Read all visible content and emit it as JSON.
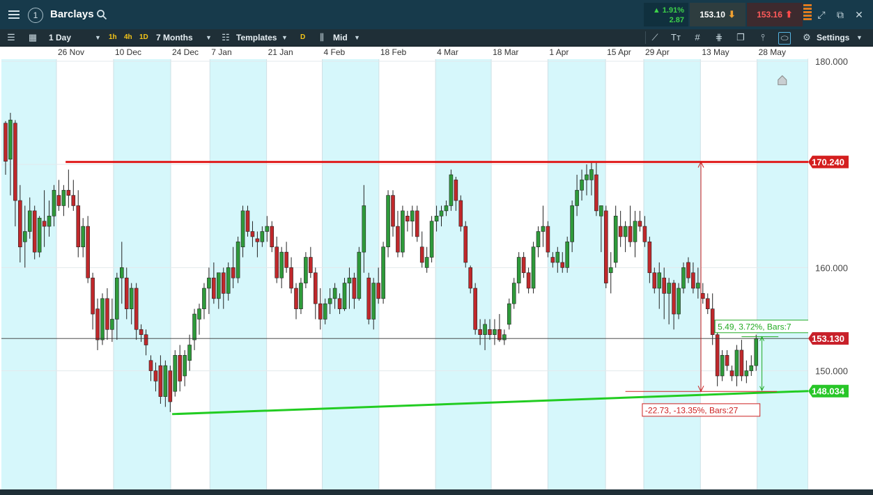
{
  "header": {
    "symbol": "Barclays",
    "account_number": "1",
    "change_pct": "▲ 1.91%",
    "change_abs": "2.87",
    "bid": "153.10",
    "ask": "153.16"
  },
  "toolbar": {
    "interval": "1 Day",
    "quick_1h": "1h",
    "quick_4h": "4h",
    "quick_1d": "1D",
    "range": "7 Months",
    "templates": "Templates",
    "d_label": "D",
    "price_type": "Mid",
    "settings": "Settings"
  },
  "chart_data": {
    "type": "candlestick",
    "x_tick_labels": [
      "26 Nov",
      "10 Dec",
      "24 Dec",
      "7 Jan",
      "21 Jan",
      "4 Feb",
      "18 Feb",
      "4 Mar",
      "18 Mar",
      "1 Apr",
      "15 Apr",
      "29 Apr",
      "13 May",
      "28 May"
    ],
    "y_tick_labels": [
      "180.000",
      "170.000",
      "160.000",
      "150.000"
    ],
    "ylim": [
      138.5,
      180.2
    ],
    "y_visible_ticks": [
      180,
      170,
      160,
      150
    ],
    "grid": true,
    "colors": {
      "up": "#2e9a3a",
      "down": "#c0282b",
      "resistance": "#e01b1b",
      "support": "#22cc22",
      "band": "#d6f7fb",
      "measure_up": "#22aa22",
      "measure_down": "#cc2020"
    },
    "current_price": 153.13,
    "current_price_label": "153.130",
    "resistance": {
      "value": 170.24,
      "label": "170.240",
      "start": "26 Nov"
    },
    "support": {
      "value": 148.034,
      "label": "148.034",
      "start_value": 145.8,
      "start": "24 Dec"
    },
    "measure_down_label": "-22.73, -13.35%, Bars:27",
    "measure_up_label": "5.49, 3.72%, Bars:7",
    "candles": [
      [
        174.0,
        174.2,
        169.0,
        170.3
      ],
      [
        170.5,
        175.0,
        167.0,
        174.3
      ],
      [
        174.0,
        174.3,
        164.0,
        166.5
      ],
      [
        166.5,
        168.0,
        160.5,
        162.0
      ],
      [
        162.5,
        166.0,
        160.0,
        163.5
      ],
      [
        163.5,
        166.8,
        162.8,
        165.5
      ],
      [
        165.5,
        166.0,
        160.8,
        161.5
      ],
      [
        161.5,
        165.0,
        161.0,
        164.8
      ],
      [
        164.5,
        167.5,
        162.0,
        164.0
      ],
      [
        164.0,
        166.5,
        163.0,
        165.0
      ],
      [
        165.0,
        168.0,
        164.0,
        167.5
      ],
      [
        167.0,
        168.5,
        165.5,
        166.0
      ],
      [
        166.0,
        168.0,
        165.0,
        167.5
      ],
      [
        167.5,
        169.5,
        165.8,
        167.0
      ],
      [
        167.0,
        168.5,
        165.5,
        166.0
      ],
      [
        166.0,
        167.5,
        161.0,
        162.0
      ],
      [
        162.0,
        164.8,
        161.0,
        164.0
      ],
      [
        164.0,
        165.0,
        158.5,
        159.0
      ],
      [
        159.0,
        159.5,
        154.0,
        155.5
      ],
      [
        156.0,
        157.0,
        152.0,
        153.0
      ],
      [
        153.0,
        157.5,
        152.5,
        157.0
      ],
      [
        157.0,
        158.0,
        153.0,
        154.0
      ],
      [
        154.0,
        157.0,
        152.8,
        155.0
      ],
      [
        155.0,
        159.5,
        153.0,
        159.0
      ],
      [
        159.0,
        162.5,
        156.5,
        160.0
      ],
      [
        159.0,
        160.0,
        155.0,
        156.0
      ],
      [
        156.0,
        158.5,
        154.5,
        158.0
      ],
      [
        158.0,
        158.5,
        153.0,
        154.0
      ],
      [
        154.0,
        154.5,
        152.8,
        153.5
      ],
      [
        153.5,
        154.0,
        151.5,
        152.5
      ],
      [
        151.0,
        151.5,
        149.0,
        150.0
      ],
      [
        150.0,
        150.8,
        148.0,
        149.0
      ],
      [
        150.5,
        151.5,
        146.8,
        147.5
      ],
      [
        147.5,
        151.0,
        146.5,
        150.5
      ],
      [
        150.0,
        150.5,
        146.0,
        147.0
      ],
      [
        148.0,
        152.0,
        147.5,
        151.5
      ],
      [
        151.5,
        152.5,
        148.0,
        149.0
      ],
      [
        149.5,
        152.0,
        148.5,
        151.5
      ],
      [
        151.0,
        153.5,
        150.0,
        152.5
      ],
      [
        153.0,
        156.0,
        152.0,
        155.5
      ],
      [
        155.0,
        156.5,
        153.5,
        156.0
      ],
      [
        156.0,
        158.5,
        155.0,
        158.0
      ],
      [
        158.0,
        160.0,
        155.5,
        159.0
      ],
      [
        159.0,
        160.5,
        156.5,
        157.0
      ],
      [
        157.0,
        159.5,
        156.0,
        159.5
      ],
      [
        159.5,
        160.0,
        156.0,
        157.5
      ],
      [
        157.5,
        160.5,
        156.8,
        160.0
      ],
      [
        160.0,
        162.0,
        158.0,
        159.0
      ],
      [
        159.0,
        163.0,
        158.5,
        162.5
      ],
      [
        162.0,
        166.0,
        161.0,
        165.5
      ],
      [
        165.5,
        166.0,
        163.0,
        163.5
      ],
      [
        163.5,
        164.5,
        162.0,
        163.0
      ],
      [
        162.8,
        163.5,
        161.0,
        162.5
      ],
      [
        162.5,
        164.0,
        162.0,
        163.5
      ],
      [
        163.5,
        165.0,
        162.5,
        164.0
      ],
      [
        164.0,
        164.5,
        161.5,
        162.0
      ],
      [
        162.0,
        163.0,
        158.5,
        159.0
      ],
      [
        159.0,
        162.0,
        158.0,
        161.5
      ],
      [
        161.5,
        162.5,
        159.5,
        160.0
      ],
      [
        160.0,
        161.0,
        157.5,
        158.0
      ],
      [
        158.0,
        158.5,
        155.0,
        156.0
      ],
      [
        156.0,
        159.0,
        155.5,
        158.5
      ],
      [
        158.5,
        161.5,
        158.0,
        161.0
      ],
      [
        161.0,
        162.0,
        159.0,
        159.5
      ],
      [
        159.5,
        160.0,
        155.0,
        156.5
      ],
      [
        156.5,
        158.0,
        154.0,
        155.0
      ],
      [
        155.0,
        157.0,
        154.5,
        156.5
      ],
      [
        156.5,
        158.0,
        155.5,
        157.0
      ],
      [
        157.0,
        158.5,
        156.0,
        158.0
      ],
      [
        157.0,
        157.5,
        155.5,
        156.0
      ],
      [
        156.0,
        159.0,
        155.8,
        158.5
      ],
      [
        158.5,
        160.0,
        156.0,
        159.0
      ],
      [
        159.0,
        159.5,
        156.0,
        157.0
      ],
      [
        157.0,
        162.0,
        156.8,
        161.5
      ],
      [
        161.5,
        168.0,
        159.5,
        166.0
      ],
      [
        159.0,
        159.5,
        154.5,
        155.0
      ],
      [
        155.0,
        159.0,
        154.0,
        158.5
      ],
      [
        158.5,
        160.0,
        156.5,
        157.0
      ],
      [
        157.0,
        162.5,
        156.5,
        162.0
      ],
      [
        162.0,
        167.5,
        161.0,
        167.0
      ],
      [
        167.0,
        167.5,
        163.0,
        164.0
      ],
      [
        164.0,
        165.5,
        161.0,
        161.5
      ],
      [
        161.5,
        166.0,
        161.0,
        165.5
      ],
      [
        165.0,
        165.5,
        163.5,
        164.5
      ],
      [
        164.5,
        166.0,
        163.0,
        165.5
      ],
      [
        165.5,
        166.0,
        162.5,
        163.0
      ],
      [
        162.0,
        163.5,
        160.0,
        160.5
      ],
      [
        160.0,
        162.0,
        159.5,
        161.0
      ],
      [
        161.0,
        165.0,
        160.5,
        164.5
      ],
      [
        164.5,
        166.0,
        163.5,
        165.0
      ],
      [
        165.0,
        166.0,
        164.0,
        165.5
      ],
      [
        165.5,
        166.5,
        165.0,
        166.0
      ],
      [
        166.0,
        169.5,
        165.5,
        169.0
      ],
      [
        168.5,
        168.8,
        165.5,
        166.5
      ],
      [
        166.5,
        167.0,
        163.5,
        164.0
      ],
      [
        164.0,
        164.5,
        160.0,
        160.5
      ],
      [
        160.0,
        160.2,
        157.5,
        158.0
      ],
      [
        158.0,
        158.5,
        153.5,
        154.0
      ],
      [
        154.0,
        155.0,
        152.5,
        153.5
      ],
      [
        153.5,
        155.0,
        152.0,
        154.5
      ],
      [
        154.0,
        155.0,
        153.0,
        153.5
      ],
      [
        153.5,
        155.0,
        152.5,
        154.0
      ],
      [
        154.0,
        155.5,
        152.8,
        153.0
      ],
      [
        153.0,
        154.0,
        152.5,
        153.5
      ],
      [
        154.5,
        157.0,
        154.0,
        156.5
      ],
      [
        156.5,
        159.0,
        156.0,
        158.5
      ],
      [
        158.5,
        161.5,
        157.5,
        161.0
      ],
      [
        161.0,
        161.5,
        159.0,
        159.5
      ],
      [
        159.5,
        160.0,
        157.5,
        158.0
      ],
      [
        158.0,
        162.5,
        157.5,
        162.0
      ],
      [
        162.0,
        164.0,
        161.0,
        163.5
      ],
      [
        163.5,
        166.0,
        162.0,
        164.0
      ],
      [
        164.0,
        164.5,
        161.0,
        161.5
      ],
      [
        161.0,
        161.5,
        160.0,
        160.5
      ],
      [
        160.5,
        162.0,
        159.5,
        161.5
      ],
      [
        160.5,
        161.5,
        159.5,
        160.0
      ],
      [
        160.0,
        163.0,
        159.5,
        162.5
      ],
      [
        162.5,
        166.5,
        161.5,
        166.0
      ],
      [
        166.0,
        169.0,
        165.0,
        167.5
      ],
      [
        167.5,
        169.5,
        166.5,
        168.5
      ],
      [
        168.5,
        170.0,
        167.0,
        169.0
      ],
      [
        168.5,
        170.2,
        167.0,
        169.5
      ],
      [
        169.0,
        170.2,
        165.0,
        165.5
      ],
      [
        165.0,
        166.0,
        161.5,
        166.0
      ],
      [
        165.5,
        166.0,
        158.0,
        158.5
      ],
      [
        159.5,
        161.5,
        157.5,
        160.0
      ],
      [
        160.5,
        166.0,
        160.0,
        165.0
      ],
      [
        164.0,
        165.5,
        162.0,
        163.0
      ],
      [
        163.0,
        164.5,
        161.5,
        164.0
      ],
      [
        164.0,
        166.0,
        162.0,
        162.5
      ],
      [
        162.5,
        165.5,
        161.0,
        164.5
      ],
      [
        164.5,
        165.5,
        163.5,
        164.0
      ],
      [
        164.0,
        165.0,
        162.0,
        162.5
      ],
      [
        162.5,
        163.0,
        158.5,
        159.5
      ],
      [
        159.5,
        160.0,
        157.5,
        158.0
      ],
      [
        158.0,
        160.5,
        156.0,
        159.5
      ],
      [
        159.0,
        160.0,
        155.0,
        157.5
      ],
      [
        157.5,
        159.0,
        154.5,
        158.5
      ],
      [
        158.5,
        158.8,
        154.0,
        155.5
      ],
      [
        155.5,
        158.5,
        155.0,
        158.0
      ],
      [
        158.0,
        160.5,
        157.5,
        160.0
      ],
      [
        160.5,
        161.0,
        158.5,
        159.0
      ],
      [
        159.5,
        160.5,
        157.5,
        158.0
      ],
      [
        158.0,
        160.0,
        157.0,
        158.5
      ],
      [
        157.5,
        158.5,
        156.5,
        157.0
      ],
      [
        157.0,
        157.5,
        155.5,
        156.0
      ],
      [
        156.0,
        157.5,
        152.5,
        153.5
      ],
      [
        153.5,
        153.8,
        148.5,
        149.5
      ],
      [
        149.5,
        152.0,
        149.0,
        151.5
      ],
      [
        151.5,
        152.0,
        150.0,
        150.5
      ],
      [
        150.0,
        150.5,
        149.0,
        149.5
      ],
      [
        149.5,
        152.5,
        148.5,
        152.0
      ],
      [
        152.0,
        153.0,
        149.0,
        149.5
      ],
      [
        149.5,
        151.0,
        148.8,
        150.0
      ],
      [
        150.0,
        151.5,
        149.5,
        150.5
      ],
      [
        150.5,
        153.5,
        150.0,
        153.1
      ]
    ]
  }
}
